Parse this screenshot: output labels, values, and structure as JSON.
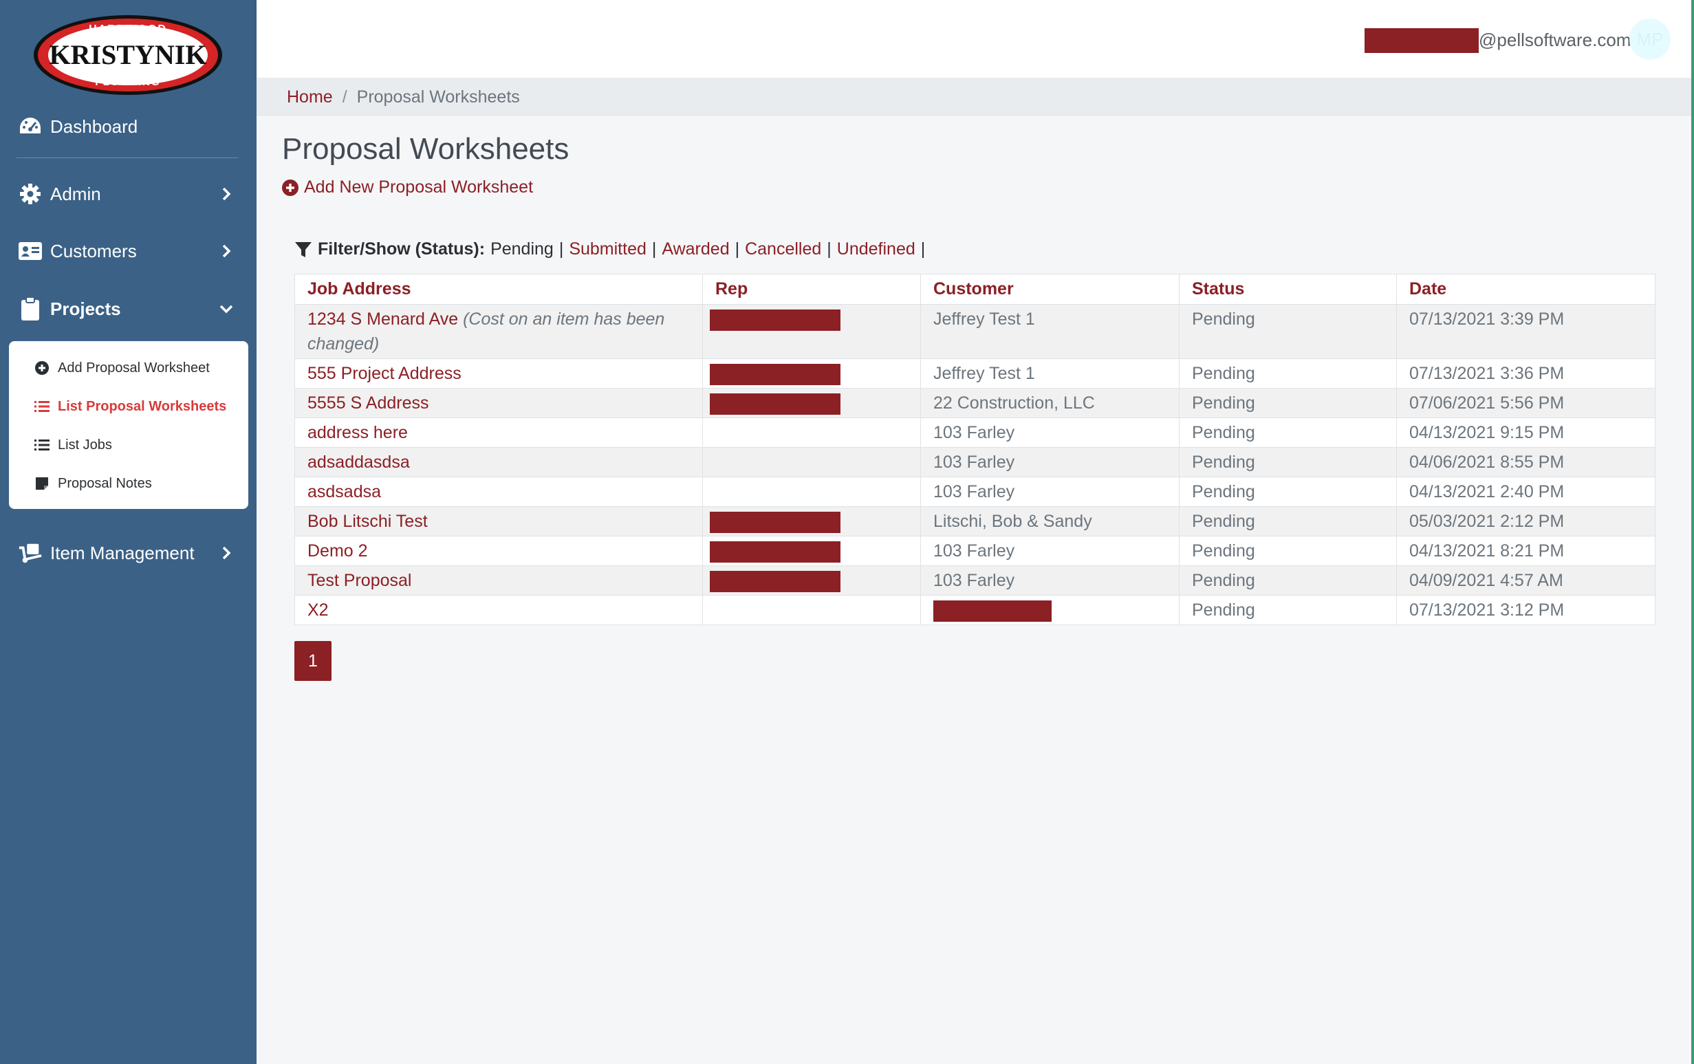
{
  "brand": {
    "logo_top": "HARDWOOD",
    "logo_main": "KRISTYNIK",
    "logo_bottom": "FLOORING"
  },
  "sidebar": {
    "items": [
      {
        "label": "Dashboard",
        "icon": "tachometer-icon"
      },
      {
        "label": "Admin",
        "icon": "gear-icon"
      },
      {
        "label": "Customers",
        "icon": "id-card-icon"
      },
      {
        "label": "Projects",
        "icon": "clipboard-icon"
      },
      {
        "label": "Item Management",
        "icon": "dolly-icon"
      }
    ],
    "projects_sub": [
      {
        "label": "Add Proposal Worksheet",
        "icon": "plus-circle-icon"
      },
      {
        "label": "List Proposal Worksheets",
        "icon": "list-icon",
        "active": true
      },
      {
        "label": "List Jobs",
        "icon": "list-icon"
      },
      {
        "label": "Proposal Notes",
        "icon": "note-icon"
      }
    ]
  },
  "header": {
    "user_email_suffix": "@pellsoftware.com",
    "avatar_initials": "MP"
  },
  "breadcrumb": {
    "home": "Home",
    "separator": "/",
    "current": "Proposal Worksheets"
  },
  "main": {
    "title": "Proposal Worksheets",
    "add_new_label": "Add New Proposal Worksheet",
    "filter": {
      "label": "Filter/Show (Status):",
      "options": [
        "Pending",
        "Submitted",
        "Awarded",
        "Cancelled",
        "Undefined"
      ],
      "trailing": "|"
    },
    "table": {
      "headers": [
        "Job Address",
        "Rep",
        "Customer",
        "Status",
        "Date"
      ],
      "rows": [
        {
          "address": "1234 S Menard Ave",
          "note": "(Cost on an item has been changed)",
          "rep_redacted": true,
          "customer": "Jeffrey Test 1",
          "status": "Pending",
          "date": "07/13/2021 3:39 PM"
        },
        {
          "address": "555 Project Address",
          "note": "",
          "rep_redacted": true,
          "customer": "Jeffrey Test 1",
          "status": "Pending",
          "date": "07/13/2021 3:36 PM"
        },
        {
          "address": "5555 S Address",
          "note": "",
          "rep_redacted": true,
          "customer": "22 Construction, LLC",
          "status": "Pending",
          "date": "07/06/2021 5:56 PM"
        },
        {
          "address": "address here",
          "note": "",
          "rep_redacted": false,
          "customer": "103 Farley",
          "status": "Pending",
          "date": "04/13/2021 9:15 PM"
        },
        {
          "address": "adsaddasdsa",
          "note": "",
          "rep_redacted": false,
          "customer": "103 Farley",
          "status": "Pending",
          "date": "04/06/2021 8:55 PM"
        },
        {
          "address": "asdsadsa",
          "note": "",
          "rep_redacted": false,
          "customer": "103 Farley",
          "status": "Pending",
          "date": "04/13/2021 2:40 PM"
        },
        {
          "address": "Bob Litschi Test",
          "note": "",
          "rep_redacted": true,
          "customer": "Litschi, Bob & Sandy",
          "status": "Pending",
          "date": "05/03/2021 2:12 PM"
        },
        {
          "address": "Demo 2",
          "note": "",
          "rep_redacted": true,
          "customer": "103 Farley",
          "status": "Pending",
          "date": "04/13/2021 8:21 PM"
        },
        {
          "address": "Test Proposal",
          "note": "",
          "rep_redacted": true,
          "customer": "103 Farley",
          "status": "Pending",
          "date": "04/09/2021 4:57 AM"
        },
        {
          "address": "X2",
          "note": "",
          "rep_redacted": false,
          "customer_redacted": true,
          "customer": "",
          "status": "Pending",
          "date": "07/13/2021 3:12 PM"
        }
      ]
    },
    "pagination": {
      "current": "1"
    }
  },
  "colors": {
    "sidebar_bg": "#3b6186",
    "accent": "#8b2025",
    "active_sub": "#d93a3a",
    "redaction": "#8b2025"
  }
}
